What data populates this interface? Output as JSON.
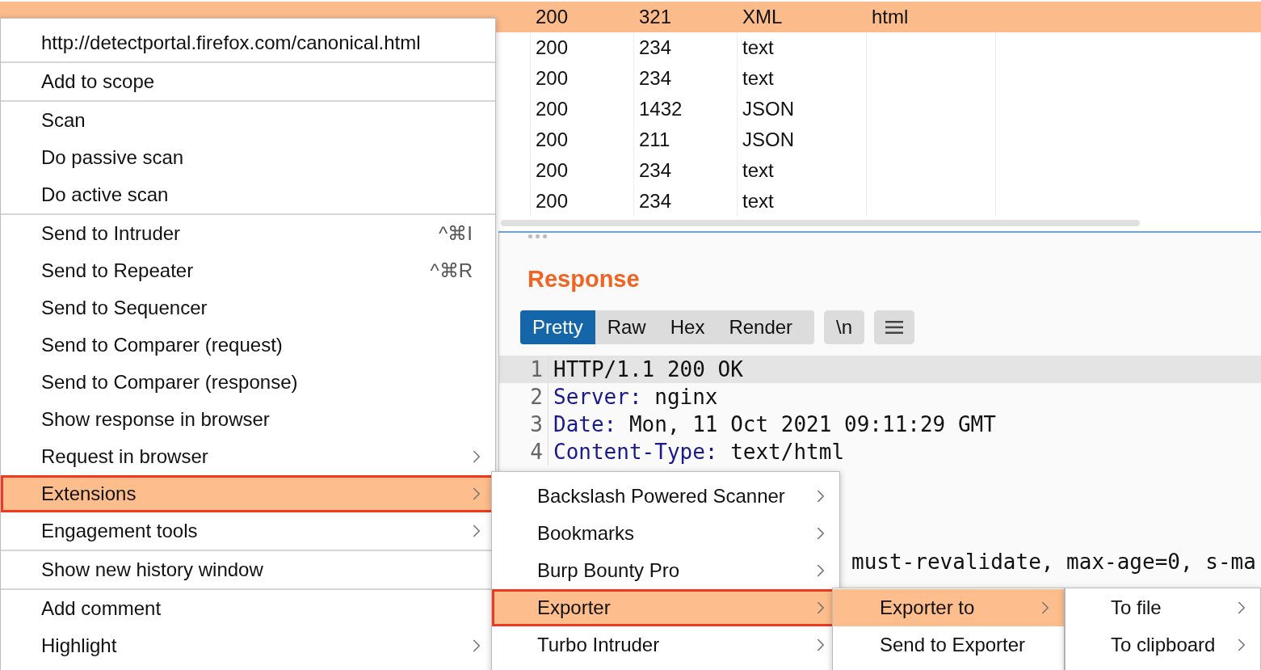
{
  "table": {
    "rows": [
      {
        "status": "200",
        "length": "321",
        "mime": "XML",
        "extension": "html",
        "selected": true
      },
      {
        "status": "200",
        "length": "234",
        "mime": "text",
        "selected": false
      },
      {
        "status": "200",
        "length": "234",
        "mime": "text",
        "selected": false
      },
      {
        "status": "200",
        "length": "1432",
        "mime": "JSON",
        "selected": false
      },
      {
        "status": "200",
        "length": "211",
        "mime": "JSON",
        "selected": false
      },
      {
        "status": "200",
        "length": "234",
        "mime": "text",
        "selected": false
      },
      {
        "status": "200",
        "length": "234",
        "mime": "text",
        "selected": false
      }
    ]
  },
  "response": {
    "title": "Response",
    "tabs": [
      {
        "label": "Pretty",
        "selected": true
      },
      {
        "label": "Raw",
        "selected": false
      },
      {
        "label": "Hex",
        "selected": false
      },
      {
        "label": "Render",
        "selected": false
      }
    ],
    "newline_button": "\\n",
    "lines": [
      {
        "number": "1",
        "key": "HTTP/1.1 200 OK",
        "selected": true
      },
      {
        "number": "2",
        "key": "Server:",
        "value": " nginx",
        "selected": false
      },
      {
        "number": "3",
        "key": "Date:",
        "value": " Mon, 11 Oct 2021 09:11:29 GMT",
        "selected": false
      },
      {
        "number": "4",
        "key": "Content-Type:",
        "value": " text/html",
        "selected": false
      }
    ],
    "partial_line": "must-revalidate, max-age=0, s-ma"
  },
  "context_menu": {
    "items": [
      {
        "kind": "item",
        "label": "http://detectportal.firefox.com/canonical.html"
      },
      {
        "kind": "separator"
      },
      {
        "kind": "item",
        "label": "Add to scope"
      },
      {
        "kind": "separator"
      },
      {
        "kind": "item",
        "label": "Scan"
      },
      {
        "kind": "item",
        "label": "Do passive scan"
      },
      {
        "kind": "item",
        "label": "Do active scan"
      },
      {
        "kind": "separator"
      },
      {
        "kind": "item",
        "label": "Send to Intruder",
        "shortcut": "^⌘I"
      },
      {
        "kind": "item",
        "label": "Send to Repeater",
        "shortcut": "^⌘R"
      },
      {
        "kind": "item",
        "label": "Send to Sequencer"
      },
      {
        "kind": "item",
        "label": "Send to Comparer (request)"
      },
      {
        "kind": "item",
        "label": "Send to Comparer (response)"
      },
      {
        "kind": "item",
        "label": "Show response in browser"
      },
      {
        "kind": "item",
        "label": "Request in browser",
        "submenu": true,
        "selected": false
      },
      {
        "kind": "item",
        "label": "Extensions",
        "submenu": true,
        "selected": true,
        "outlined": true,
        "children": [
          {
            "kind": "item",
            "label": "Backslash Powered Scanner",
            "submenu": true,
            "selected": false
          },
          {
            "kind": "item",
            "label": "Bookmarks",
            "submenu": true,
            "selected": false
          },
          {
            "kind": "item",
            "label": "Burp Bounty Pro",
            "submenu": true,
            "selected": false
          },
          {
            "kind": "item",
            "label": "Exporter",
            "submenu": true,
            "selected": true,
            "outlined": true,
            "children": [
              {
                "kind": "item",
                "label": "Exporter to",
                "submenu": true,
                "selected": true,
                "outlined": false,
                "children": [
                  {
                    "kind": "item",
                    "label": "To file",
                    "submenu": true,
                    "selected": false
                  },
                  {
                    "kind": "item",
                    "label": "To clipboard",
                    "submenu": true,
                    "selected": false
                  }
                ]
              },
              {
                "kind": "item",
                "label": "Send to Exporter",
                "selected": false
              }
            ]
          },
          {
            "kind": "item",
            "label": "Turbo Intruder",
            "submenu": true,
            "selected": false
          }
        ]
      },
      {
        "kind": "item",
        "label": "Engagement tools",
        "submenu": true,
        "selected": false
      },
      {
        "kind": "separator"
      },
      {
        "kind": "item",
        "label": "Show new history window"
      },
      {
        "kind": "separator"
      },
      {
        "kind": "item",
        "label": "Add comment"
      },
      {
        "kind": "item",
        "label": "Highlight",
        "submenu": true,
        "selected": false
      }
    ]
  }
}
